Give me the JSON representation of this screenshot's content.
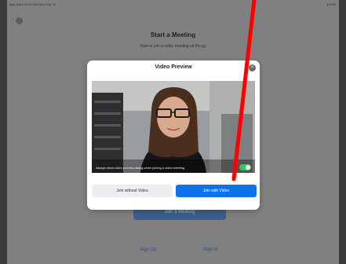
{
  "status_bar": {
    "left_text": "App Store 10:16 AM Wed Sep 16",
    "right_text": "● 81%"
  },
  "background": {
    "title": "Start a Meeting",
    "subtitle": "Start or join a video meeting on the go",
    "join_button": "Join a Meeting",
    "sign_up": "Sign Up",
    "sign_in": "Sign In"
  },
  "modal": {
    "title": "Video Preview",
    "close_glyph": "×",
    "preview_toggle_label": "Always show video preview dialog when joining a video meeting",
    "preview_toggle_on": true,
    "join_without_video": "Join without Video",
    "join_with_video": "Join with Video"
  },
  "colors": {
    "primary": "#0e72ed",
    "toggle_on": "#34c759",
    "annotation": "#ff0000"
  }
}
